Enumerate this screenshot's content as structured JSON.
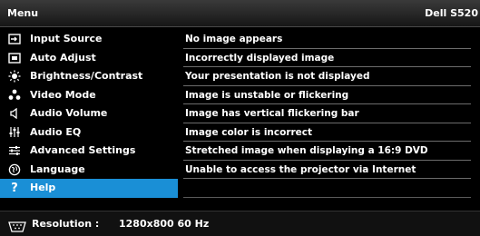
{
  "header": {
    "title": "Menu",
    "model": "Dell S520"
  },
  "menu": {
    "items": [
      {
        "label": "Input Source",
        "icon": "input-source-icon"
      },
      {
        "label": "Auto Adjust",
        "icon": "auto-adjust-icon"
      },
      {
        "label": "Brightness/Contrast",
        "icon": "brightness-icon"
      },
      {
        "label": "Video Mode",
        "icon": "video-mode-icon"
      },
      {
        "label": "Audio Volume",
        "icon": "speaker-icon"
      },
      {
        "label": "Audio EQ",
        "icon": "equalizer-icon"
      },
      {
        "label": "Advanced Settings",
        "icon": "advanced-settings-icon"
      },
      {
        "label": "Language",
        "icon": "globe-icon"
      },
      {
        "label": "Help",
        "icon": "question-icon",
        "selected": true
      }
    ]
  },
  "help_topics": [
    "No image appears",
    "Incorrectly displayed image",
    "Your presentation is not displayed",
    "Image is unstable or flickering",
    "Image has vertical flickering bar",
    "Image color is incorrect",
    "Stretched image when displaying a 16:9 DVD",
    "Unable to access the projector via Internet",
    "",
    ""
  ],
  "footer": {
    "resolution_label": "Resolution :",
    "resolution_value": "1280x800 60 Hz"
  },
  "colors": {
    "accent": "#1a8fd6",
    "background": "#000000",
    "text": "#ffffff"
  }
}
